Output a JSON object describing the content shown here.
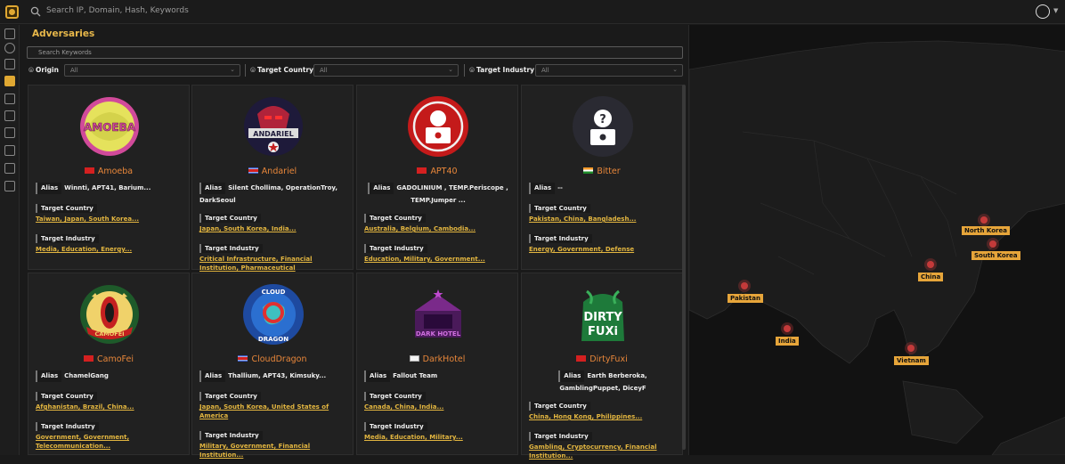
{
  "search": {
    "placeholder": "Search IP, Domain, Hash, Keywords"
  },
  "panel": {
    "title": "Adversaries",
    "keywords_placeholder": "Search Keywords",
    "filters": [
      {
        "label": "Origin",
        "value": "All"
      },
      {
        "label": "Target Country",
        "value": "All"
      },
      {
        "label": "Target Industry",
        "value": "All"
      }
    ]
  },
  "cards": [
    {
      "name": "Amoeba",
      "flag": "cn",
      "alias": "Winnti, APT41, Barium...",
      "target_country_label": "Target Country",
      "countries": "Taiwan, Japan, South Korea...",
      "target_industry_label": "Target Industry",
      "industries": "Media, Education, Energy...",
      "alias_label": "Alias"
    },
    {
      "name": "Andariel",
      "flag": "kp",
      "alias": "Silent Chollima, OperationTroy, DarkSeoul",
      "target_country_label": "Target Country",
      "countries": "Japan, South Korea, India...",
      "target_industry_label": "Target Industry",
      "industries": "Critical Infrastructure, Financial Institution, Pharmaceutical",
      "alias_label": "Alias"
    },
    {
      "name": "APT40",
      "flag": "cn",
      "alias": "GADOLINIUM , TEMP.Periscope , TEMP.Jumper ...",
      "target_country_label": "Target Country",
      "countries": "Australia, Belgium, Cambodia...",
      "target_industry_label": "Target Industry",
      "industries": "Education, Military, Government...",
      "alias_label": "Alias"
    },
    {
      "name": "Bitter",
      "flag": "in",
      "alias": "--",
      "target_country_label": "Target Country",
      "countries": "Pakistan, China, Bangladesh...",
      "target_industry_label": "Target Industry",
      "industries": "Energy, Government, Defense",
      "alias_label": "Alias"
    },
    {
      "name": "CamoFei",
      "flag": "cn",
      "alias": "ChamelGang",
      "target_country_label": "Target Country",
      "countries": "Afghanistan, Brazil, China...",
      "target_industry_label": "Target Industry",
      "industries": "Government, Government, Telecommunication...",
      "alias_label": "Alias"
    },
    {
      "name": "CloudDragon",
      "flag": "kp",
      "alias": "Thallium, APT43, Kimsuky...",
      "target_country_label": "Target Country",
      "countries": "Japan, South Korea, United States of America",
      "target_industry_label": "Target Industry",
      "industries": "Military, Government, Financial Institution...",
      "alias_label": "Alias"
    },
    {
      "name": "DarkHotel",
      "flag": "kr",
      "alias": "Fallout Team",
      "target_country_label": "Target Country",
      "countries": "Canada, China, India...",
      "target_industry_label": "Target Industry",
      "industries": "Media, Education, Military...",
      "alias_label": "Alias"
    },
    {
      "name": "DirtyFuxi",
      "flag": "cn",
      "alias": "Earth Berberoka, GamblingPuppet, DiceyF",
      "target_country_label": "Target Country",
      "countries": "China, Hong Kong, Philippines...",
      "target_industry_label": "Target Industry",
      "industries": "Gambling, Cryptocurrency, Financial Institution...",
      "alias_label": "Alias"
    }
  ],
  "logo_texts": {
    "amoeba": "AMOEBA",
    "andariel": "ANDARIEL",
    "camofei": "CAMOFEI",
    "cloud_top": "CLOUD",
    "cloud_bottom": "DRAGON",
    "darkhotel": "DARK HOTEL",
    "dirty": "DIRTY",
    "fuxi": "FUXi"
  },
  "map_labels": [
    "North Korea",
    "South Korea",
    "China",
    "Pakistan",
    "India",
    "Vietnam"
  ],
  "colors": {
    "accent": "#e8b84a",
    "name": "#e9873a",
    "link": "#e3b640",
    "marker": "#c43a3a"
  }
}
